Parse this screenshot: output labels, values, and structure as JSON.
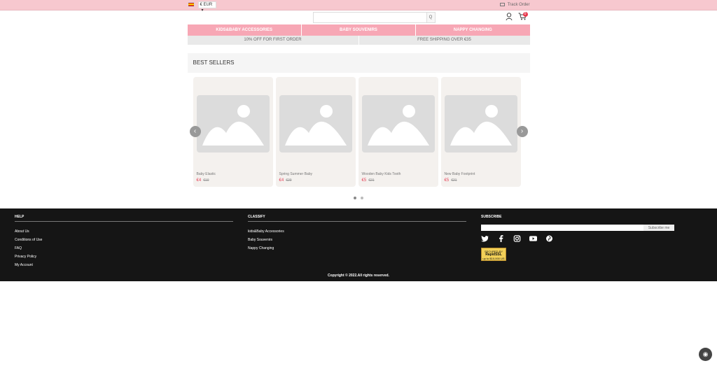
{
  "topbar": {
    "currency": "€ EUR",
    "track_order": "Track Order"
  },
  "header": {
    "search_placeholder": "",
    "search_button": "Q",
    "cart_count": "0"
  },
  "nav": [
    "KIDS&BABY ACCESSORIES",
    "BABY SOUVENIRS",
    "NAPPY CHANGING"
  ],
  "promo": [
    "10% OFF FOR FIRST ORDER",
    "FREE SHIPPING OVER €35"
  ],
  "best_sellers": {
    "title": "BEST SELLERS",
    "products": [
      {
        "name": "Baby Elastic",
        "price": "€4",
        "old_price": "€19"
      },
      {
        "name": "Spring Summer Baby",
        "price": "€4",
        "old_price": "€29"
      },
      {
        "name": "Wooden Baby Kids Tooth",
        "price": "€5",
        "old_price": "€21"
      },
      {
        "name": "New Baby Footprint",
        "price": "€5",
        "old_price": "€21"
      }
    ]
  },
  "footer": {
    "help_title": "HELP",
    "help_links": [
      "About Us",
      "Conditions of Use",
      "FAQ",
      "Privacy Policy",
      "My Account"
    ],
    "classify_title": "CLASSIFY",
    "classify_links": [
      "kids&Baby Accessories",
      "Baby Souvenirs",
      "Nappy Changing"
    ],
    "subscribe_title": "SUBSCRIBE",
    "subscribe_button": "Subscribe me",
    "seal_top": "SECURED BY",
    "seal_main": "RapidSSL",
    "seal_bottom": "up to $10,000 US",
    "copyright": "Copyright © 2022.All rights reserved."
  },
  "colors": {
    "topbar": "#f7c8cf",
    "nav": "#f7a7b5",
    "price": "#e7455a",
    "footer": "#151515"
  }
}
